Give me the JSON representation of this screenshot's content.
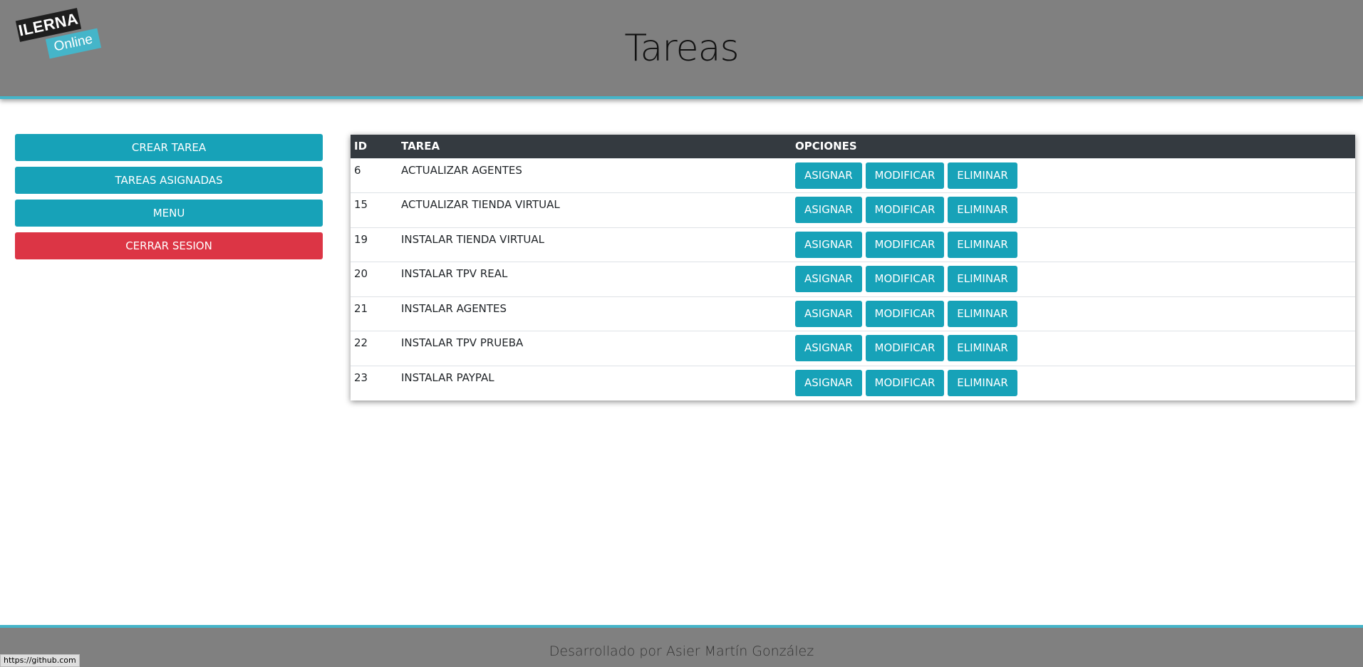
{
  "header": {
    "logo_top": "ILERNA",
    "logo_bottom": "Online",
    "title": "Tareas"
  },
  "sidebar": {
    "buttons": [
      {
        "label": "CREAR TAREA"
      },
      {
        "label": "TAREAS ASIGNADAS"
      },
      {
        "label": "MENU"
      },
      {
        "label": "CERRAR SESION"
      }
    ]
  },
  "table": {
    "headers": [
      "ID",
      "TAREA",
      "OPCIONES"
    ],
    "actions": [
      "ASIGNAR",
      "MODIFICAR",
      "ELIMINAR"
    ],
    "rows": [
      {
        "id": "6",
        "tarea": "ACTUALIZAR AGENTES"
      },
      {
        "id": "15",
        "tarea": "ACTUALIZAR TIENDA VIRTUAL"
      },
      {
        "id": "19",
        "tarea": "INSTALAR TIENDA VIRTUAL"
      },
      {
        "id": "20",
        "tarea": "INSTALAR TPV REAL"
      },
      {
        "id": "21",
        "tarea": "INSTALAR AGENTES"
      },
      {
        "id": "22",
        "tarea": "INSTALAR TPV PRUEBA"
      },
      {
        "id": "23",
        "tarea": "INSTALAR PAYPAL"
      }
    ]
  },
  "footer": {
    "text": "Desarrollado por Asier Martín González"
  },
  "status_bar": {
    "url": "https://github.com"
  },
  "colors": {
    "header_bg": "#808080",
    "accent": "#45b5c9",
    "info_button": "#17a2b8",
    "danger_button": "#dc3545",
    "table_header": "#343a40"
  }
}
